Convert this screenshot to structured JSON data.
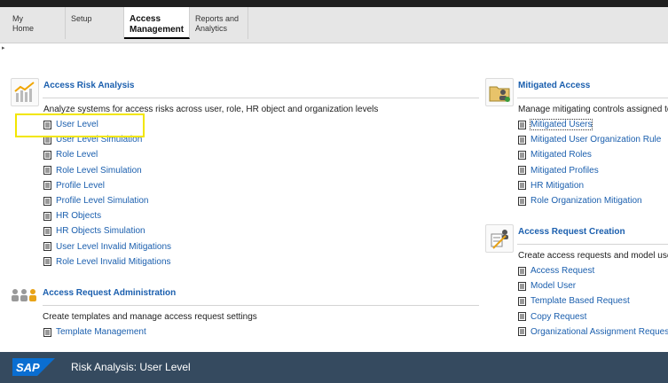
{
  "tabs": [
    {
      "label": "My\nHome"
    },
    {
      "label": "Setup"
    },
    {
      "label": "Access\nManagement"
    },
    {
      "label": "Reports and\nAnalytics"
    }
  ],
  "sections": {
    "ara": {
      "title": "Access Risk Analysis",
      "desc": "Analyze systems for access risks across user, role, HR object and organization levels",
      "links": [
        "User Level",
        "User Level Simulation",
        "Role Level",
        "Role Level Simulation",
        "Profile Level",
        "Profile Level Simulation",
        "HR Objects",
        "HR Objects Simulation",
        "User Level Invalid Mitigations",
        "Role Level Invalid Mitigations"
      ]
    },
    "ma": {
      "title": "Mitigated Access",
      "desc": "Manage mitigating controls assigned to",
      "links": [
        "Mitigated Users",
        "Mitigated User Organization Rule",
        "Mitigated Roles",
        "Mitigated Profiles",
        "HR Mitigation",
        "Role Organization Mitigation"
      ]
    },
    "arc": {
      "title": "Access Request Creation",
      "desc": "Create access requests and model use",
      "links": [
        "Access Request",
        "Model User",
        "Template Based Request",
        "Copy Request",
        "Organizational Assignment Request"
      ]
    },
    "ara_admin": {
      "title": "Access Request Administration",
      "desc": "Create templates and manage access request settings",
      "links": [
        "Template Management"
      ]
    }
  },
  "footer": {
    "logo": "SAP",
    "title": "Risk Analysis: User Level"
  },
  "colors": {
    "link": "#1b5fae",
    "footer": "#354a5f",
    "highlight": "#f2e600"
  }
}
